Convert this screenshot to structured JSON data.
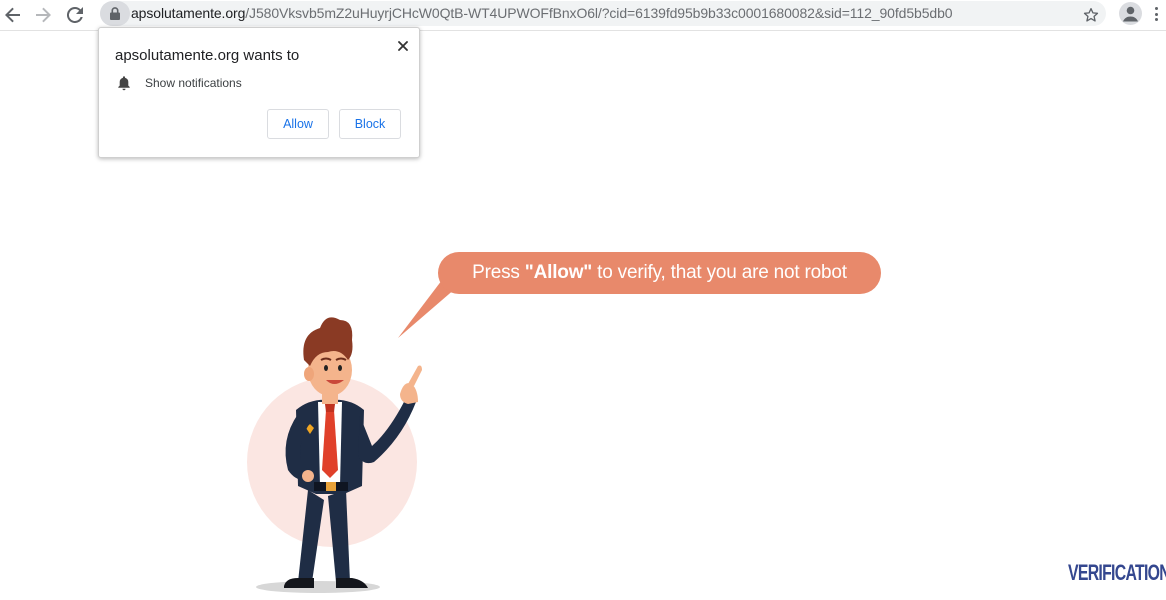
{
  "browser": {
    "url_host": "apsolutamente.org",
    "url_path": "/J580Vksvb5mZ2uHuyrjCHcW0QtB-WT4UPWOFfBnxO6l/?cid=6139fd95b9b33c0001680082&sid=112_90fd5b5db0",
    "icons": [
      "back-icon",
      "forward-icon",
      "reload-icon",
      "lock-icon",
      "star-icon",
      "account-icon",
      "menu-icon"
    ]
  },
  "permission_popup": {
    "title": "apsolutamente.org wants to",
    "permission_label": "Show notifications",
    "allow_label": "Allow",
    "block_label": "Block",
    "icons": [
      "bell-icon",
      "close-icon"
    ]
  },
  "page": {
    "bubble_prefix": "Press ",
    "bubble_highlight": "\"Allow\"",
    "bubble_suffix": " to verify, that you are not robot",
    "logo_text": "VERIFICATION"
  },
  "colors": {
    "bubble": "#e8896b",
    "accent_blue": "#1a73e8",
    "logo": "#34478f",
    "circle": "#fbe6e2"
  }
}
